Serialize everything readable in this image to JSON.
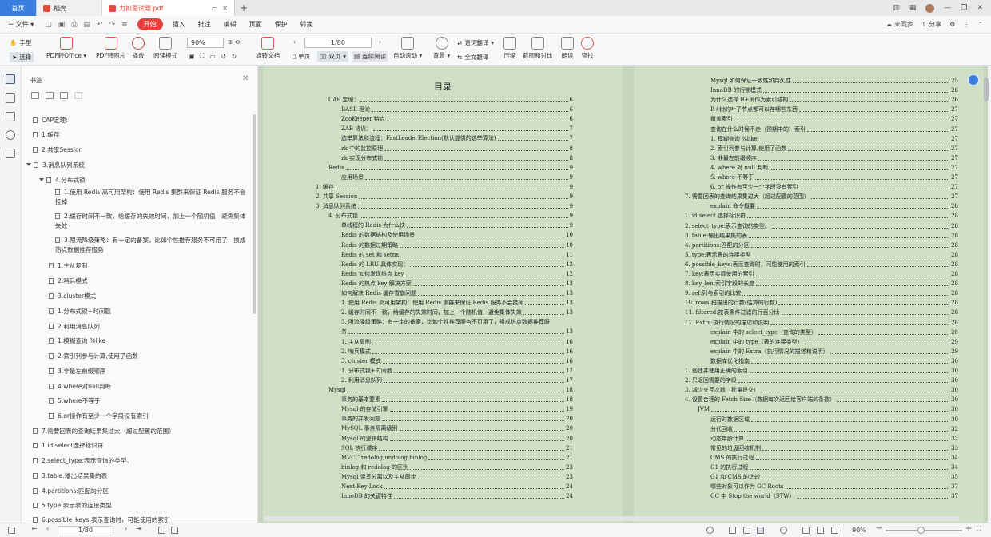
{
  "tabs": [
    {
      "label": "首页"
    },
    {
      "label": "稻壳"
    },
    {
      "label": "力扣面试题.pdf"
    }
  ],
  "menu": {
    "file": "文件",
    "start": "开始",
    "items": [
      "插入",
      "批注",
      "编辑",
      "页面",
      "保护",
      "转换"
    ],
    "right": [
      "未同步",
      "分享"
    ]
  },
  "toolbar": {
    "hand": "手型",
    "select": "选择",
    "pdf_to_office": "PDF转Office",
    "pdf_to_image": "PDF转图片",
    "play": "播放",
    "read_mode": "阅读模式",
    "zoom": "90%",
    "rotate": "旋转文档",
    "page_input": "1/80",
    "single_page": "单页",
    "double_page": "双页",
    "continuous": "连续阅读",
    "auto_scroll": "自动滚动",
    "background": "背景",
    "word_translate": "划词翻译",
    "full_translate": "全文翻译",
    "compress": "压缩",
    "screenshot_compare": "截图和对比",
    "read_aloud": "朗读",
    "find": "查找"
  },
  "sidebar": {
    "title": "书签",
    "bookmarks": [
      {
        "label": "CAP定理:"
      },
      {
        "label": "1.缓存"
      },
      {
        "label": "2.共享Session"
      },
      {
        "label": "3.消息队列系统"
      },
      {
        "label": "4.分布式锁"
      },
      {
        "label": "1.使用 Redis 高可用架构：使用 Redis 集群来保证 Redis 服务不会"
      },
      {
        "label": "挂掉"
      },
      {
        "label": "2.缓存时间不一致，给缓存的失效时间，加上一个随机值，避免集体"
      },
      {
        "label": "失效"
      },
      {
        "label": "3.限流降级策略：有一定的备案，比如个性推荐服务不可用了，换成"
      },
      {
        "label": "热点数据推荐服务"
      },
      {
        "label": "1.主从复制"
      },
      {
        "label": "2.哨兵模式"
      },
      {
        "label": "3.cluster模式"
      },
      {
        "label": "1.分布式锁+时间戳"
      },
      {
        "label": "2.利用消息队列"
      },
      {
        "label": "1.模糊查询 %like"
      },
      {
        "label": "2.索引列参与计算,使用了函数"
      },
      {
        "label": "3.非最左前缀顺序"
      },
      {
        "label": "4.where对null判断"
      },
      {
        "label": "5.where不等于"
      },
      {
        "label": "6.or操作有至少一个字段没有索引"
      },
      {
        "label": "7.需要回表的查询结果集过大（超过配置的范围）"
      },
      {
        "label": "1.id:select选择标识符"
      },
      {
        "label": "2.select_type:表示查询的类型。"
      },
      {
        "label": "3.table:输出结果集的表"
      },
      {
        "label": "4.partitions:匹配的分区"
      },
      {
        "label": "5.type:表示表的连接类型"
      },
      {
        "label": "6.possible_keys:表示查询时，可能使用的索引"
      }
    ]
  },
  "document": {
    "toc_title": "目录",
    "left_toc": [
      {
        "text": "CAP 定理：",
        "page": "6"
      },
      {
        "text": "BASE 理论",
        "page": "6"
      },
      {
        "text": "ZooKeeper 特点",
        "page": "6"
      },
      {
        "text": "ZAB 协议：",
        "page": "7"
      },
      {
        "text": "选举算法和流程：FastLeaderElection(默认提供的选举算法)",
        "page": "7"
      },
      {
        "text": "zk 中的监控原理",
        "page": "8"
      },
      {
        "text": "zk 实现分布式锁",
        "page": "8"
      },
      {
        "text": "Redis",
        "page": "9"
      },
      {
        "text": "应用场景",
        "page": "9"
      },
      {
        "text": "1. 缓存",
        "page": "9"
      },
      {
        "text": "2. 共享 Session",
        "page": "9"
      },
      {
        "text": "3. 消息队列系统",
        "page": "9"
      },
      {
        "text": "4. 分布式锁",
        "page": "9"
      },
      {
        "text": "单线程的 Redis 为什么快",
        "page": "9"
      },
      {
        "text": "Redis 的数据结构及使用场景",
        "page": "10"
      },
      {
        "text": "Redis 的数据过期策略",
        "page": "10"
      },
      {
        "text": "Redis 的 set 和 setnx",
        "page": "11"
      },
      {
        "text": "Redis 的 LRU 具体实现：",
        "page": "12"
      },
      {
        "text": "Redis 如何发现热点 key",
        "page": "12"
      },
      {
        "text": "Redis 的热点 key 解决方案",
        "page": "13"
      },
      {
        "text": "如何解决 Redis 缓存雪崩问题",
        "page": "13"
      },
      {
        "text": "1. 使用 Redis 高可用架构：使用 Redis 集群来保证 Redis 服务不会挂掉",
        "page": "13"
      },
      {
        "text": "2. 缓存时间不一致，给缓存的失效时间，加上一个随机值，避免集体失效",
        "page": "13"
      },
      {
        "text": "3. 限流降级策略：有一定的备案，比如个性推荐服务不可用了，换成热点数据推荐服",
        "page": ""
      },
      {
        "text": "务",
        "page": "13"
      },
      {
        "text": "1. 主从复制",
        "page": "16"
      },
      {
        "text": "2. 哨兵模式",
        "page": "16"
      },
      {
        "text": "3. cluster 模式",
        "page": "16"
      },
      {
        "text": "1. 分布式锁+时间戳",
        "page": "17"
      },
      {
        "text": "2. 利用消息队列",
        "page": "17"
      },
      {
        "text": "Mysql",
        "page": "18"
      },
      {
        "text": "事务的基本要素",
        "page": "18"
      },
      {
        "text": "Mysql 的存储引擎",
        "page": "19"
      },
      {
        "text": "事务的并发问题",
        "page": "20"
      },
      {
        "text": "MySQL 事务隔离级别",
        "page": "20"
      },
      {
        "text": "Mysql 的逻辑结构",
        "page": "20"
      },
      {
        "text": "SQL 执行顺序",
        "page": "21"
      },
      {
        "text": "MVCC,redolog,undolog,binlog",
        "page": "21"
      },
      {
        "text": "binlog 和 redolog 的区别",
        "page": "23"
      },
      {
        "text": "Mysql 读写分离以及主从同步",
        "page": "23"
      },
      {
        "text": "Next-Key Lock",
        "page": "24"
      },
      {
        "text": "InnoDB 的关键特性",
        "page": "24"
      }
    ],
    "right_toc": [
      {
        "text": "Mysql 如何保证一致性和持久性",
        "page": "25"
      },
      {
        "text": "InnoDB 的行锁模式",
        "page": "26"
      },
      {
        "text": "为什么选择 B+树作为索引结构",
        "page": "26"
      },
      {
        "text": "B+树的叶子节点都可以存哪些东西",
        "page": "27"
      },
      {
        "text": "覆盖索引",
        "page": "27"
      },
      {
        "text": "查询在什么时候不走（预期中的）索引",
        "page": "27"
      },
      {
        "text": "1. 模糊查询 %like",
        "page": "27"
      },
      {
        "text": "2. 索引列参与计算,使用了函数",
        "page": "27"
      },
      {
        "text": "3. 非最左前缀顺序",
        "page": "27"
      },
      {
        "text": "4. where 对 null 判断",
        "page": "27"
      },
      {
        "text": "5. where 不等于",
        "page": "27"
      },
      {
        "text": "6. or 操作有至少一个字段没有索引",
        "page": "27"
      },
      {
        "text": "7. 需要回表的查询结果集过大（超过配置的范围）",
        "page": "27"
      },
      {
        "text": "explain 命令概要",
        "page": "28"
      },
      {
        "text": "1. id:select 选择标识符",
        "page": "28"
      },
      {
        "text": "2. select_type:表示查询的类型。",
        "page": "28"
      },
      {
        "text": "3. table:输出结果集的表",
        "page": "28"
      },
      {
        "text": "4. partitions:匹配的分区",
        "page": "28"
      },
      {
        "text": "5. type:表示表的连接类型",
        "page": "28"
      },
      {
        "text": "6. possible_keys:表示查询时，可能使用的索引",
        "page": "28"
      },
      {
        "text": "7. key:表示实际使用的索引",
        "page": "28"
      },
      {
        "text": "8. key_len:索引字段的长度",
        "page": "28"
      },
      {
        "text": "9. ref:列与索引的比较",
        "page": "28"
      },
      {
        "text": "10. rows:扫描出的行数(估算的行数)",
        "page": "28"
      },
      {
        "text": "11. filtered:按表条件过滤的行百分比",
        "page": "28"
      },
      {
        "text": "12. Extra:执行情况的描述和说明",
        "page": "28"
      },
      {
        "text": "explain 中的 select_type（查询的类型）",
        "page": "28"
      },
      {
        "text": "explain 中的 type（表的连接类型）",
        "page": "29"
      },
      {
        "text": "explain 中的 Extra（执行情况的描述和说明）",
        "page": "29"
      },
      {
        "text": "数据库优化指南",
        "page": "30"
      },
      {
        "text": "1. 创建并使用正确的索引",
        "page": "30"
      },
      {
        "text": "2. 只返回需要的字段",
        "page": "30"
      },
      {
        "text": "3. 减少交互次数（批量提交）",
        "page": "30"
      },
      {
        "text": "4. 设置合理的 Fetch Size（数据每次返回给客户端的条数）",
        "page": "30"
      },
      {
        "text": "JVM",
        "page": "30"
      },
      {
        "text": "运行时数据区域",
        "page": "30"
      },
      {
        "text": "分代回收",
        "page": "32"
      },
      {
        "text": "动态年龄计算",
        "page": "32"
      },
      {
        "text": "常见的垃圾回收机制",
        "page": "33"
      },
      {
        "text": "CMS 的执行过程",
        "page": "34"
      },
      {
        "text": "G1 的执行过程",
        "page": "34"
      },
      {
        "text": "G1 和 CMS 的比较",
        "page": "35"
      },
      {
        "text": "哪些对象可以作为 GC Roots",
        "page": "37"
      },
      {
        "text": "GC 中 Stop the world（STW）",
        "page": "37"
      }
    ]
  },
  "statusbar": {
    "page": "1/80",
    "zoom": "90%"
  }
}
